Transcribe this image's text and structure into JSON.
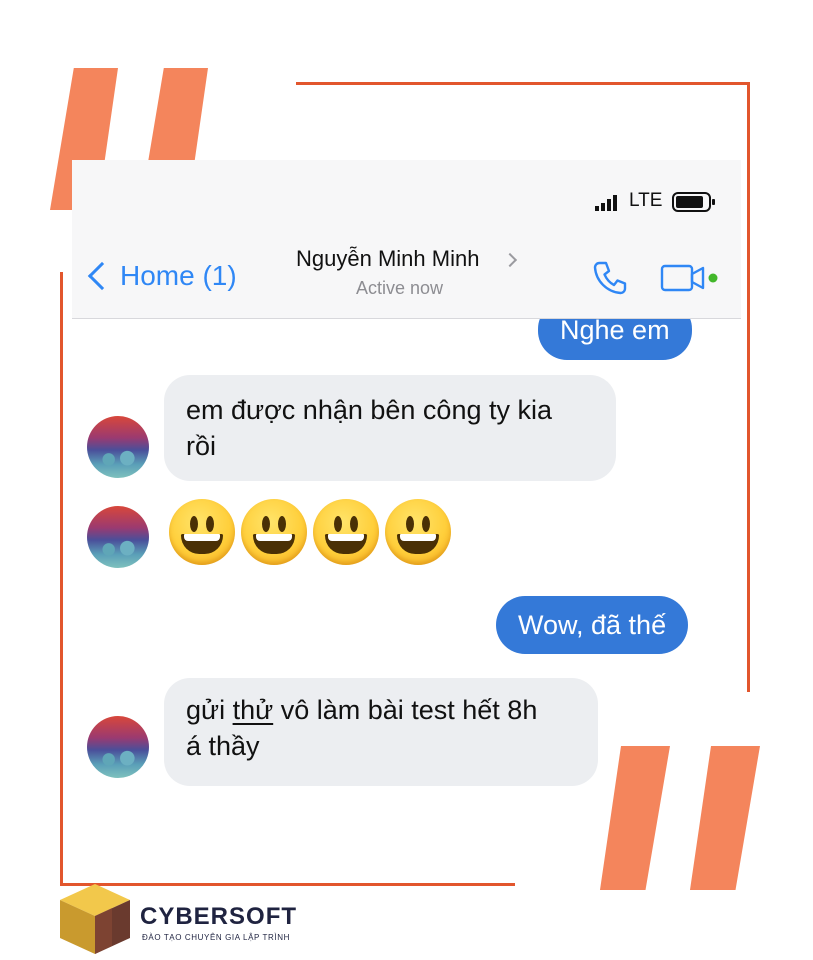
{
  "status_bar": {
    "network": "LTE"
  },
  "nav": {
    "back_label": "Home (1)",
    "contact_name": "Nguyễn Minh Minh",
    "contact_status": "Active now"
  },
  "messages": [
    {
      "direction": "outgoing",
      "text": "Nghe em"
    },
    {
      "direction": "incoming",
      "line1": "em được nhận bên công ty kia",
      "line2": "rồi"
    },
    {
      "direction": "incoming",
      "emoji": [
        "😀",
        "😀",
        "😀",
        "😀"
      ]
    },
    {
      "direction": "outgoing",
      "text": "Wow, đã thế"
    },
    {
      "direction": "incoming",
      "line1_pre": "gửi ",
      "line1_link": "thử",
      "line1_post": " vô làm bài test hết 8h",
      "line2": "á thầy"
    }
  ],
  "brand": {
    "name": "CYBERSOFT",
    "tagline": "ĐÀO TẠO CHUYÊN GIA LẬP TRÌNH",
    "quote_color": "#f4855c",
    "frame_color": "#e2562d"
  },
  "theme": {
    "accent": "#2f87f5",
    "outgoing_bubble": "#3479d8",
    "incoming_bubble": "#eceef1"
  }
}
